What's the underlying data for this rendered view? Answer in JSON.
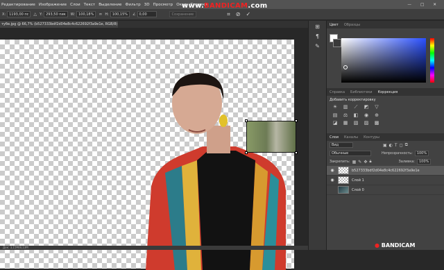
{
  "menubar": {
    "items": [
      "Редактирование",
      "Изображение",
      "Слои",
      "Текст",
      "Выделение",
      "Фильтр",
      "3D",
      "Просмотр",
      "Окно",
      "Справка"
    ]
  },
  "options": {
    "x_label": "X:",
    "x_value": "1193,00 пс",
    "y_label": "Y:",
    "y_value": "293,50 пик",
    "w_label": "W:",
    "w_value": "100,18%",
    "h_label": "H:",
    "h_value": "100,15%",
    "angle_value": "0,00",
    "interp_label": "Сохранение"
  },
  "watermark": {
    "prefix": "www.",
    "brand": "BANDICAM",
    "suffix": ".com"
  },
  "document_tab": {
    "label": "тубе.jpg @ 66,7% (b527333bdf2d04e8c4c622692f3a9e1e, RGB/8) *"
  },
  "status": {
    "text": "Док: 3,15M/8,13M"
  },
  "color_panel": {
    "tabs": [
      "Цвет",
      "Образцы"
    ]
  },
  "adjust_panel": {
    "tabs": [
      "Справка",
      "Библиотеки",
      "Коррекция"
    ],
    "title": "Добавить корректировку"
  },
  "layers_panel": {
    "tabs": [
      "Слои",
      "Каналы",
      "Контуры"
    ],
    "kind_label": "Вид",
    "blend_mode": "Обычные",
    "opacity_label": "Непрозрачность:",
    "opacity_value": "100%",
    "lock_label": "Закрепить:",
    "fill_label": "Заливка:",
    "fill_value": "100%",
    "layers": [
      {
        "name": "b527333bdf2d04e8c4c622692f3a9e1e",
        "selected": true
      },
      {
        "name": "Слой 1",
        "selected": false
      },
      {
        "name": "Слой 0",
        "selected": false
      }
    ]
  },
  "bottom_watermark": {
    "brand": "BANDICAM"
  }
}
